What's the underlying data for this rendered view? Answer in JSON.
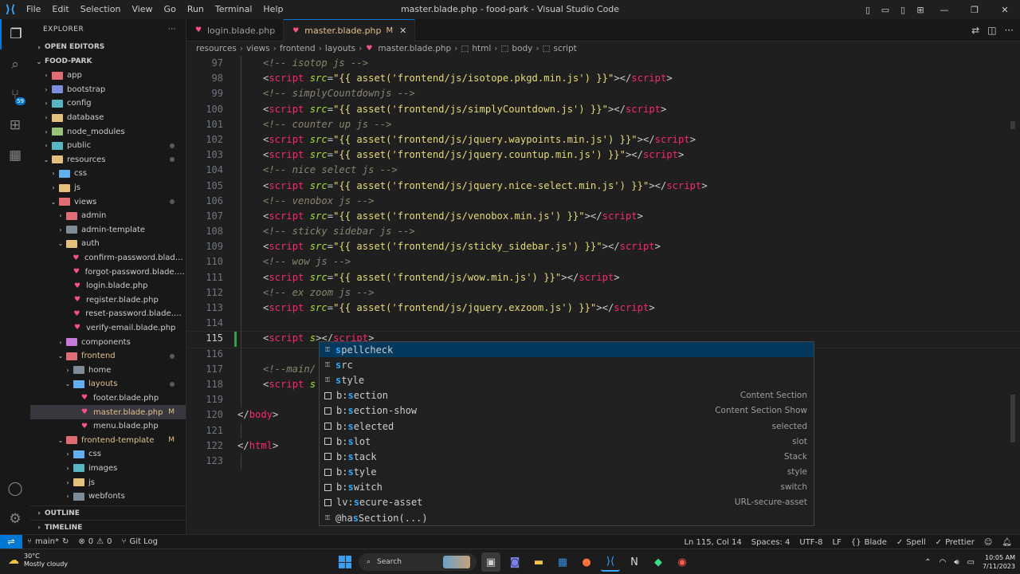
{
  "titlebar": {
    "menu": [
      "File",
      "Edit",
      "Selection",
      "View",
      "Go",
      "Run",
      "Terminal",
      "Help"
    ],
    "title": "master.blade.php - food-park - Visual Studio Code"
  },
  "sidebar": {
    "header": "EXPLORER",
    "open_editors": "OPEN EDITORS",
    "project": "FOOD-PARK",
    "outline": "OUTLINE",
    "timeline": "TIMELINE",
    "tree": [
      {
        "name": "app",
        "depth": 1,
        "kind": "folder",
        "color": "#e06c75",
        "open": false
      },
      {
        "name": "bootstrap",
        "depth": 1,
        "kind": "folder",
        "color": "#7c8cde",
        "open": false
      },
      {
        "name": "config",
        "depth": 1,
        "kind": "folder",
        "color": "#56b6c2",
        "open": false
      },
      {
        "name": "database",
        "depth": 1,
        "kind": "folder",
        "color": "#e5c07b",
        "open": false
      },
      {
        "name": "node_modules",
        "depth": 1,
        "kind": "folder",
        "color": "#98c379",
        "open": false
      },
      {
        "name": "public",
        "depth": 1,
        "kind": "folder",
        "color": "#56b6c2",
        "open": false,
        "dot": true
      },
      {
        "name": "resources",
        "depth": 1,
        "kind": "folder",
        "color": "#e5c07b",
        "open": true,
        "dot": true
      },
      {
        "name": "css",
        "depth": 2,
        "kind": "folder",
        "color": "#61afef",
        "open": false
      },
      {
        "name": "js",
        "depth": 2,
        "kind": "folder",
        "color": "#e5c07b",
        "open": false
      },
      {
        "name": "views",
        "depth": 2,
        "kind": "folder",
        "color": "#e06c75",
        "open": true,
        "dot": true
      },
      {
        "name": "admin",
        "depth": 3,
        "kind": "folder",
        "color": "#e06c75",
        "open": false
      },
      {
        "name": "admin-template",
        "depth": 3,
        "kind": "folder",
        "color": "#7f8c98",
        "open": false
      },
      {
        "name": "auth",
        "depth": 3,
        "kind": "folder",
        "color": "#e5c07b",
        "open": true
      },
      {
        "name": "confirm-password.blade.p...",
        "depth": 4,
        "kind": "file"
      },
      {
        "name": "forgot-password.blade.php",
        "depth": 4,
        "kind": "file"
      },
      {
        "name": "login.blade.php",
        "depth": 4,
        "kind": "file"
      },
      {
        "name": "register.blade.php",
        "depth": 4,
        "kind": "file"
      },
      {
        "name": "reset-password.blade.php",
        "depth": 4,
        "kind": "file"
      },
      {
        "name": "verify-email.blade.php",
        "depth": 4,
        "kind": "file"
      },
      {
        "name": "components",
        "depth": 3,
        "kind": "folder",
        "color": "#c678dd",
        "open": false
      },
      {
        "name": "frontend",
        "depth": 3,
        "kind": "folder",
        "color": "#e06c75",
        "open": true,
        "modified": true,
        "dot": true
      },
      {
        "name": "home",
        "depth": 4,
        "kind": "folder",
        "color": "#7f8c98",
        "open": false
      },
      {
        "name": "layouts",
        "depth": 4,
        "kind": "folder",
        "color": "#61afef",
        "open": true,
        "modified": true,
        "dot": true
      },
      {
        "name": "footer.blade.php",
        "depth": 5,
        "kind": "file"
      },
      {
        "name": "master.blade.php",
        "depth": 5,
        "kind": "file",
        "modified": true,
        "badge": "M",
        "selected": true
      },
      {
        "name": "menu.blade.php",
        "depth": 5,
        "kind": "file"
      },
      {
        "name": "frontend-template",
        "depth": 3,
        "kind": "folder",
        "color": "#e06c75",
        "open": true,
        "modified": true,
        "badge": "M"
      },
      {
        "name": "css",
        "depth": 4,
        "kind": "folder",
        "color": "#61afef",
        "open": false
      },
      {
        "name": "images",
        "depth": 4,
        "kind": "folder",
        "color": "#56b6c2",
        "open": false
      },
      {
        "name": "js",
        "depth": 4,
        "kind": "folder",
        "color": "#e5c07b",
        "open": false
      },
      {
        "name": "webfonts",
        "depth": 4,
        "kind": "folder",
        "color": "#7f8c98",
        "open": false
      }
    ]
  },
  "tabs": [
    {
      "label": "login.blade.php",
      "active": false
    },
    {
      "label": "master.blade.php",
      "active": true,
      "modified": "M"
    }
  ],
  "breadcrumb": [
    "resources",
    "views",
    "frontend",
    "layouts",
    "master.blade.php",
    "html",
    "body",
    "script"
  ],
  "editor": {
    "lines": [
      {
        "no": "97",
        "parts": [
          [
            "c-comment",
            "<!-- isotop js -->"
          ]
        ]
      },
      {
        "no": "98",
        "parts": [
          [
            "c-angle",
            "<"
          ],
          [
            "c-tag",
            "script"
          ],
          [
            "c-plain",
            " "
          ],
          [
            "c-attr",
            "src"
          ],
          [
            "c-eq",
            "="
          ],
          [
            "c-str",
            "\"{{ asset('frontend/js/isotope.pkgd.min.js') }}\""
          ],
          [
            "c-angle",
            "></"
          ],
          [
            "c-tag",
            "script"
          ],
          [
            "c-angle",
            ">"
          ]
        ]
      },
      {
        "no": "99",
        "parts": [
          [
            "c-comment",
            "<!-- simplyCountdownjs -->"
          ]
        ]
      },
      {
        "no": "100",
        "parts": [
          [
            "c-angle",
            "<"
          ],
          [
            "c-tag",
            "script"
          ],
          [
            "c-plain",
            " "
          ],
          [
            "c-attr",
            "src"
          ],
          [
            "c-eq",
            "="
          ],
          [
            "c-str",
            "\"{{ asset('frontend/js/simplyCountdown.js') }}\""
          ],
          [
            "c-angle",
            "></"
          ],
          [
            "c-tag",
            "script"
          ],
          [
            "c-angle",
            ">"
          ]
        ]
      },
      {
        "no": "101",
        "parts": [
          [
            "c-comment",
            "<!-- counter up js -->"
          ]
        ]
      },
      {
        "no": "102",
        "parts": [
          [
            "c-angle",
            "<"
          ],
          [
            "c-tag",
            "script"
          ],
          [
            "c-plain",
            " "
          ],
          [
            "c-attr",
            "src"
          ],
          [
            "c-eq",
            "="
          ],
          [
            "c-str",
            "\"{{ asset('frontend/js/jquery.waypoints.min.js') }}\""
          ],
          [
            "c-angle",
            "></"
          ],
          [
            "c-tag",
            "script"
          ],
          [
            "c-angle",
            ">"
          ]
        ]
      },
      {
        "no": "103",
        "parts": [
          [
            "c-angle",
            "<"
          ],
          [
            "c-tag",
            "script"
          ],
          [
            "c-plain",
            " "
          ],
          [
            "c-attr",
            "src"
          ],
          [
            "c-eq",
            "="
          ],
          [
            "c-str",
            "\"{{ asset('frontend/js/jquery.countup.min.js') }}\""
          ],
          [
            "c-angle",
            "></"
          ],
          [
            "c-tag",
            "script"
          ],
          [
            "c-angle",
            ">"
          ]
        ]
      },
      {
        "no": "104",
        "parts": [
          [
            "c-comment",
            "<!-- nice select js -->"
          ]
        ]
      },
      {
        "no": "105",
        "parts": [
          [
            "c-angle",
            "<"
          ],
          [
            "c-tag",
            "script"
          ],
          [
            "c-plain",
            " "
          ],
          [
            "c-attr",
            "src"
          ],
          [
            "c-eq",
            "="
          ],
          [
            "c-str",
            "\"{{ asset('frontend/js/jquery.nice-select.min.js') }}\""
          ],
          [
            "c-angle",
            "></"
          ],
          [
            "c-tag",
            "script"
          ],
          [
            "c-angle",
            ">"
          ]
        ]
      },
      {
        "no": "106",
        "parts": [
          [
            "c-comment",
            "<!-- venobox js -->"
          ]
        ]
      },
      {
        "no": "107",
        "parts": [
          [
            "c-angle",
            "<"
          ],
          [
            "c-tag",
            "script"
          ],
          [
            "c-plain",
            " "
          ],
          [
            "c-attr",
            "src"
          ],
          [
            "c-eq",
            "="
          ],
          [
            "c-str",
            "\"{{ asset('frontend/js/venobox.min.js') }}\""
          ],
          [
            "c-angle",
            "></"
          ],
          [
            "c-tag",
            "script"
          ],
          [
            "c-angle",
            ">"
          ]
        ]
      },
      {
        "no": "108",
        "parts": [
          [
            "c-comment",
            "<!-- sticky sidebar js -->"
          ]
        ]
      },
      {
        "no": "109",
        "parts": [
          [
            "c-angle",
            "<"
          ],
          [
            "c-tag",
            "script"
          ],
          [
            "c-plain",
            " "
          ],
          [
            "c-attr",
            "src"
          ],
          [
            "c-eq",
            "="
          ],
          [
            "c-str",
            "\"{{ asset('frontend/js/sticky_sidebar.js') }}\""
          ],
          [
            "c-angle",
            "></"
          ],
          [
            "c-tag",
            "script"
          ],
          [
            "c-angle",
            ">"
          ]
        ]
      },
      {
        "no": "110",
        "parts": [
          [
            "c-comment",
            "<!-- wow js -->"
          ]
        ]
      },
      {
        "no": "111",
        "parts": [
          [
            "c-angle",
            "<"
          ],
          [
            "c-tag",
            "script"
          ],
          [
            "c-plain",
            " "
          ],
          [
            "c-attr",
            "src"
          ],
          [
            "c-eq",
            "="
          ],
          [
            "c-str",
            "\"{{ asset('frontend/js/wow.min.js') }}\""
          ],
          [
            "c-angle",
            "></"
          ],
          [
            "c-tag",
            "script"
          ],
          [
            "c-angle",
            ">"
          ]
        ]
      },
      {
        "no": "112",
        "parts": [
          [
            "c-comment",
            "<!-- ex zoom js -->"
          ]
        ]
      },
      {
        "no": "113",
        "parts": [
          [
            "c-angle",
            "<"
          ],
          [
            "c-tag",
            "script"
          ],
          [
            "c-plain",
            " "
          ],
          [
            "c-attr",
            "src"
          ],
          [
            "c-eq",
            "="
          ],
          [
            "c-str",
            "\"{{ asset('frontend/js/jquery.exzoom.js') }}\""
          ],
          [
            "c-angle",
            "></"
          ],
          [
            "c-tag",
            "script"
          ],
          [
            "c-angle",
            ">"
          ]
        ]
      },
      {
        "no": "114",
        "parts": []
      },
      {
        "no": "115",
        "current": true,
        "parts": [
          [
            "c-angle",
            "<"
          ],
          [
            "c-tag",
            "script"
          ],
          [
            "c-plain",
            " "
          ],
          [
            "c-attr",
            "s"
          ],
          [
            "c-angle",
            "></"
          ],
          [
            "c-tag",
            "script"
          ],
          [
            "c-angle",
            ">"
          ]
        ]
      },
      {
        "no": "116",
        "parts": []
      },
      {
        "no": "117",
        "parts": [
          [
            "c-comment",
            "<!--main/"
          ]
        ]
      },
      {
        "no": "118",
        "parts": [
          [
            "c-angle",
            "<"
          ],
          [
            "c-tag",
            "script"
          ],
          [
            "c-plain",
            " "
          ],
          [
            "c-attr",
            "s"
          ]
        ]
      },
      {
        "no": "119",
        "parts": []
      },
      {
        "no": "120",
        "outdent": true,
        "parts": [
          [
            "c-angle",
            "</"
          ],
          [
            "c-tag",
            "body"
          ],
          [
            "c-angle",
            ">"
          ]
        ]
      },
      {
        "no": "121",
        "parts": []
      },
      {
        "no": "122",
        "outdent": true,
        "parts": [
          [
            "c-angle",
            "</"
          ],
          [
            "c-tag",
            "html"
          ],
          [
            "c-angle",
            ">"
          ]
        ]
      },
      {
        "no": "123",
        "parts": []
      }
    ]
  },
  "suggest": [
    {
      "kind": "prop",
      "pre": "",
      "hl": "s",
      "rest": "pellcheck",
      "detail": "",
      "focused": true
    },
    {
      "kind": "prop",
      "pre": "",
      "hl": "s",
      "rest": "rc",
      "detail": ""
    },
    {
      "kind": "prop",
      "pre": "",
      "hl": "s",
      "rest": "tyle",
      "detail": ""
    },
    {
      "kind": "snip",
      "pre": "b:",
      "hl": "s",
      "rest": "ection",
      "detail": "Content Section"
    },
    {
      "kind": "snip",
      "pre": "b:",
      "hl": "s",
      "rest": "ection-show",
      "detail": "Content Section Show"
    },
    {
      "kind": "snip",
      "pre": "b:",
      "hl": "s",
      "rest": "elected",
      "detail": "selected"
    },
    {
      "kind": "snip",
      "pre": "b:",
      "hl": "s",
      "rest": "lot",
      "detail": "slot"
    },
    {
      "kind": "snip",
      "pre": "b:",
      "hl": "s",
      "rest": "tack",
      "detail": "Stack"
    },
    {
      "kind": "snip",
      "pre": "b:",
      "hl": "s",
      "rest": "tyle",
      "detail": "style"
    },
    {
      "kind": "snip",
      "pre": "b:",
      "hl": "s",
      "rest": "witch",
      "detail": "switch"
    },
    {
      "kind": "snip",
      "pre": "lv:",
      "hl": "s",
      "rest": "ecure-asset",
      "detail": "URL-secure-asset"
    },
    {
      "kind": "prop",
      "pre": "@ha",
      "hl": "s",
      "rest": "Section(...)",
      "detail": ""
    }
  ],
  "statusbar": {
    "branch": "main*",
    "errors": "0",
    "warnings": "0",
    "gitlog": "Git Log",
    "position": "Ln 115, Col 14",
    "spaces": "Spaces: 4",
    "encoding": "UTF-8",
    "eol": "LF",
    "language": "Blade",
    "spell": "Spell",
    "prettier": "Prettier"
  },
  "activity_badge": "59",
  "taskbar": {
    "temp": "30°C",
    "weather": "Mostly cloudy",
    "search": "Search",
    "time": "10:05 AM",
    "date": "7/11/2023"
  }
}
